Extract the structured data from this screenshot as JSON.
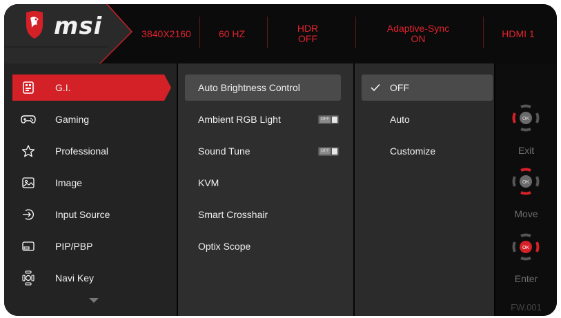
{
  "brand": {
    "logo_text": "msi",
    "accent": "#d42128"
  },
  "header": {
    "status": [
      {
        "lines": [
          "3840X2160"
        ]
      },
      {
        "lines": [
          "60 HZ"
        ]
      },
      {
        "lines": [
          "HDR",
          "OFF"
        ]
      },
      {
        "lines": [
          "Adaptive-Sync",
          "ON"
        ]
      },
      {
        "lines": [
          "HDMI 1"
        ]
      }
    ]
  },
  "menu": {
    "items": [
      {
        "label": "G.I.",
        "icon": "gi-icon",
        "active": true
      },
      {
        "label": "Gaming",
        "icon": "gamepad-icon"
      },
      {
        "label": "Professional",
        "icon": "star-icon"
      },
      {
        "label": "Image",
        "icon": "image-icon"
      },
      {
        "label": "Input Source",
        "icon": "input-source-icon"
      },
      {
        "label": "PIP/PBP",
        "icon": "pip-icon"
      },
      {
        "label": "Navi Key",
        "icon": "joystick-icon"
      }
    ],
    "more_icon": "chevron-down-icon"
  },
  "submenu": {
    "items": [
      {
        "label": "Auto Brightness Control",
        "active": true
      },
      {
        "label": "Ambient RGB Light",
        "toggle": "OFF"
      },
      {
        "label": "Sound Tune",
        "toggle": "OFF"
      },
      {
        "label": "KVM"
      },
      {
        "label": "Smart Crosshair"
      },
      {
        "label": "Optix Scope"
      }
    ]
  },
  "options": {
    "items": [
      {
        "label": "OFF",
        "checked": true
      },
      {
        "label": "Auto"
      },
      {
        "label": "Customize"
      }
    ]
  },
  "nav": {
    "hints": [
      {
        "label": "Exit",
        "icon": "joystick-exit-icon",
        "ok": "OK"
      },
      {
        "label": "Move",
        "icon": "joystick-move-icon",
        "ok": "OK"
      },
      {
        "label": "Enter",
        "icon": "joystick-enter-icon",
        "ok": "OK"
      }
    ],
    "firmware": "FW.001"
  }
}
